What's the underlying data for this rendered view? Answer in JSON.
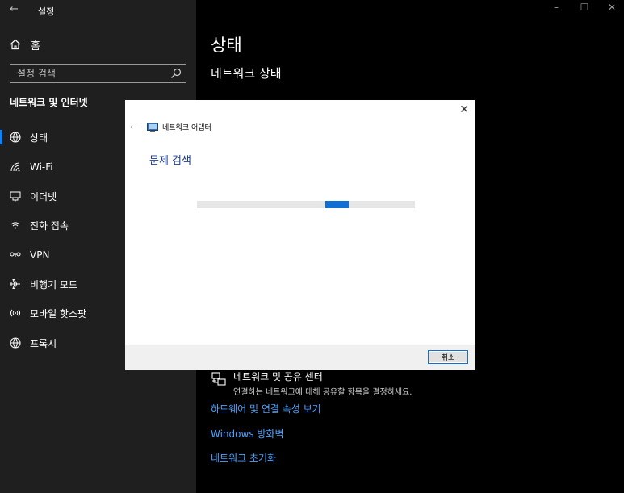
{
  "window": {
    "back_glyph": "←",
    "title": "설정",
    "minimize_glyph": "–",
    "maximize_glyph": "☐",
    "close_glyph": "✕"
  },
  "sidebar": {
    "home_label": "홈",
    "search_placeholder": "설정 검색",
    "section_title": "네트워크 및 인터넷",
    "items": [
      {
        "label": "상태",
        "icon": "globe-status-icon"
      },
      {
        "label": "Wi-Fi",
        "icon": "wifi-icon"
      },
      {
        "label": "이더넷",
        "icon": "ethernet-icon"
      },
      {
        "label": "전화 접속",
        "icon": "dialup-icon"
      },
      {
        "label": "VPN",
        "icon": "vpn-icon"
      },
      {
        "label": "비행기 모드",
        "icon": "airplane-icon"
      },
      {
        "label": "모바일 핫스팟",
        "icon": "hotspot-icon"
      },
      {
        "label": "프록시",
        "icon": "globe-icon"
      }
    ]
  },
  "main": {
    "title": "상태",
    "subtitle": "네트워크 상태",
    "sharing_center": {
      "title": "네트워크 및 공유 센터",
      "description": "연결하는 네트워크에 대해 공유할 항목을 결정하세요."
    },
    "links": [
      "하드웨어 및 연결 속성 보기",
      "Windows 방화벽",
      "네트워크 초기화"
    ]
  },
  "dialog": {
    "close_glyph": "✕",
    "back_glyph": "←",
    "app_title": "네트워크 어댑터",
    "heading": "문제 검색",
    "progress_fraction": 0.66,
    "cancel_label": "취소"
  },
  "colors": {
    "accent": "#0a84ff",
    "link": "#4aa2ff",
    "dialog_heading": "#1e3f8f",
    "progress": "#0f6fd4"
  }
}
